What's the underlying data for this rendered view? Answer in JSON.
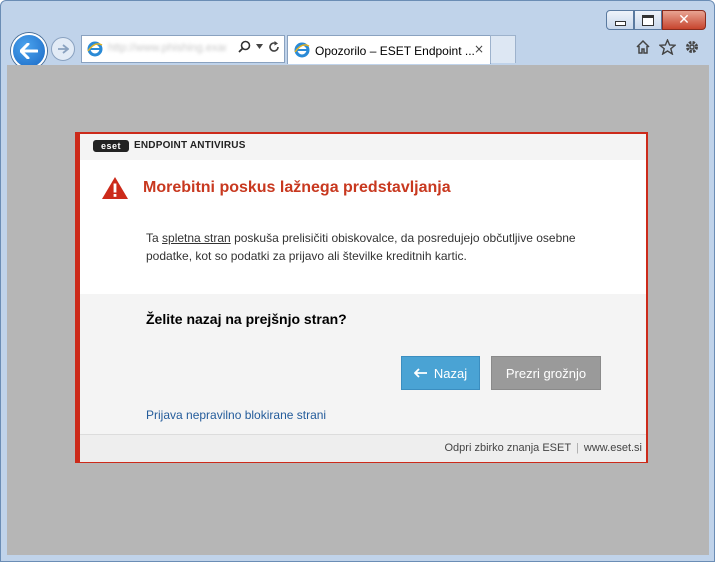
{
  "browser": {
    "address_url": "http://www.phishing.example.com",
    "tab_title": "Opozorilo – ESET Endpoint ...",
    "tab_close": "×",
    "window_close": "✕"
  },
  "dialog": {
    "brand": "eset",
    "product": "ENDPOINT ANTIVIRUS",
    "title": "Morebitni poskus lažnega predstavljanja",
    "desc_prefix": "Ta ",
    "desc_link": "spletna stran",
    "desc_rest": " poskuša prelisičiti obiskovalce, da posredujejo občutljive osebne podatke, kot so podatki za prijavo ali številke kreditnih kartic.",
    "question": "Želite nazaj na prejšnjo stran?",
    "back_button": "Nazaj",
    "ignore_button": "Prezri grožnjo",
    "report_link": "Prijava nepravilno blokirane strani",
    "footer_kb": "Odpri zbirko znanja ESET",
    "footer_separator": "|",
    "footer_site": "www.eset.si"
  },
  "colors": {
    "accent_red": "#cc2a1a",
    "title_red": "#c8381f",
    "button_blue": "#4aa3d4",
    "button_grey": "#9a9a9a",
    "link_blue": "#245c9b"
  }
}
